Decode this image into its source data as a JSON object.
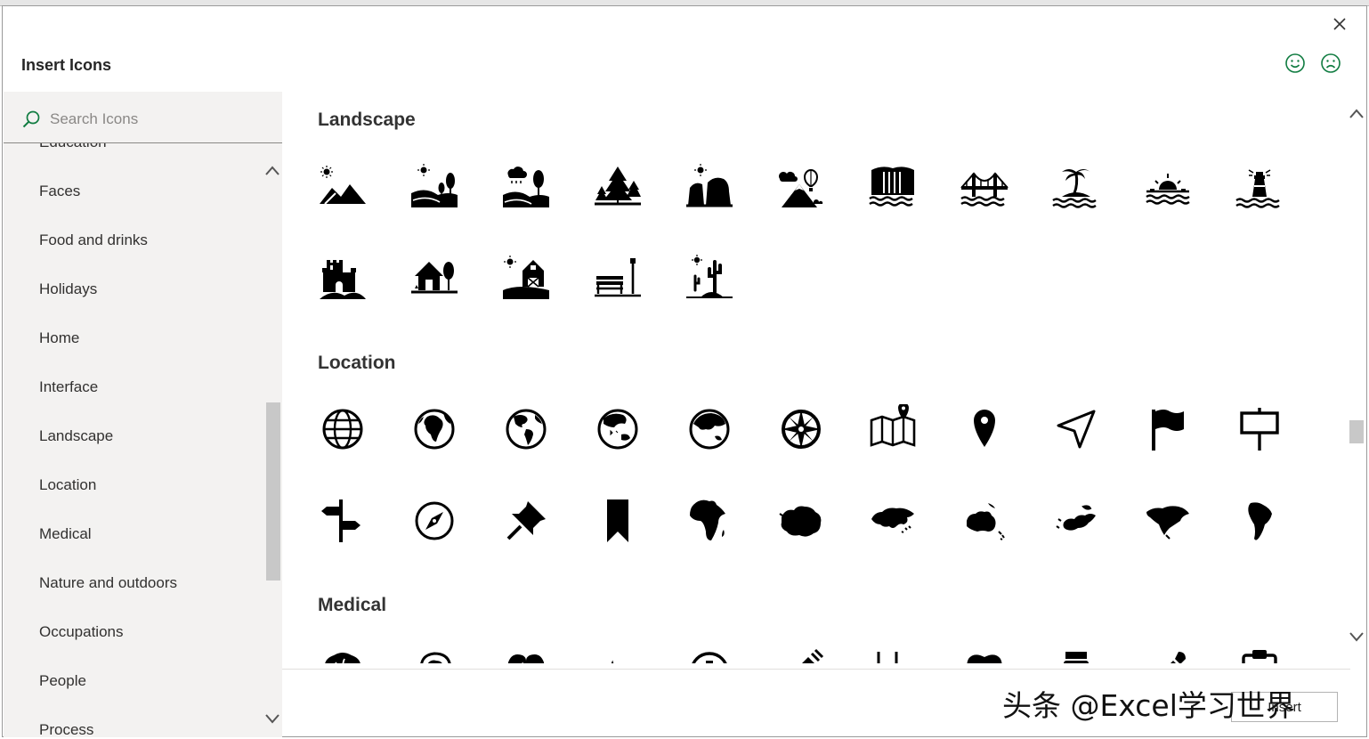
{
  "dialog": {
    "title": "Insert Icons",
    "close_icon": "close-icon",
    "feedback": {
      "smile_icon": "smile-icon",
      "frown_icon": "frown-icon"
    },
    "accent_color": "#107c41"
  },
  "sidebar": {
    "search": {
      "placeholder": "Search Icons",
      "icon": "search-icon",
      "value": ""
    },
    "categories": [
      "Education",
      "Faces",
      "Food and drinks",
      "Holidays",
      "Home",
      "Interface",
      "Landscape",
      "Location",
      "Medical",
      "Nature and outdoors",
      "Occupations",
      "People",
      "Process"
    ]
  },
  "sections": [
    {
      "title": "Landscape",
      "icons": [
        "sun-mountains-icon",
        "sun-hills-trees-icon",
        "rain-cloud-hills-tree-icon",
        "pine-trees-icon",
        "sun-cliffs-icon",
        "hot-air-balloon-mountain-icon",
        "waterfall-icon",
        "bridge-icon",
        "palm-tree-island-icon",
        "sunset-icon",
        "lighthouse-icon",
        "castle-icon",
        "house-with-tree-icon",
        "barn-icon",
        "park-bench-lamp-icon",
        "desert-cactus-icon"
      ]
    },
    {
      "title": "Location",
      "icons": [
        "globe-grid-icon",
        "globe-africa-icon",
        "globe-americas-icon",
        "globe-asia-australia-icon",
        "globe-asia-icon",
        "compass-rose-icon",
        "map-pin-icon",
        "location-pin-icon",
        "navigation-arrow-icon",
        "flag-icon",
        "signboard-icon",
        "signpost-icon",
        "compass-icon",
        "push-pin-icon",
        "bookmark-icon",
        "africa-icon",
        "antarctica-icon",
        "asia-icon",
        "australia-icon",
        "europe-icon",
        "north-america-icon",
        "south-america-icon"
      ]
    },
    {
      "title": "Medical",
      "icons": [
        "brain-icon",
        "head-brain-icon",
        "heart-pulse-icon",
        "heartbeat-line-icon",
        "medical-cross-icon",
        "syringe-icon",
        "stethoscope-icon",
        "tooth-icon",
        "pill-bottle-icon",
        "dropper-icon",
        "clipboard-icon"
      ]
    }
  ],
  "footer": {
    "insert_label": "Insert"
  },
  "watermark": "头条 @Excel学习世界"
}
